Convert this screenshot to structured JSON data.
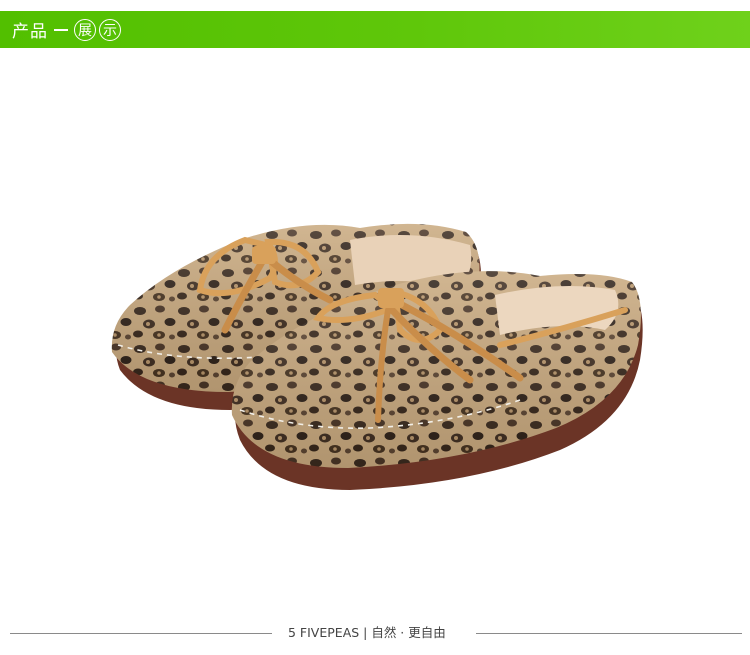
{
  "header": {
    "title_prefix": "产品",
    "title_circle_1": "展",
    "title_circle_2": "示",
    "accent_color": "#5cc30a"
  },
  "product_image": {
    "subject": "leopard-print children's loafers with tan leather bow laces"
  },
  "footer": {
    "text": "5 FIVEPEAS | 自然 · 更自由"
  }
}
